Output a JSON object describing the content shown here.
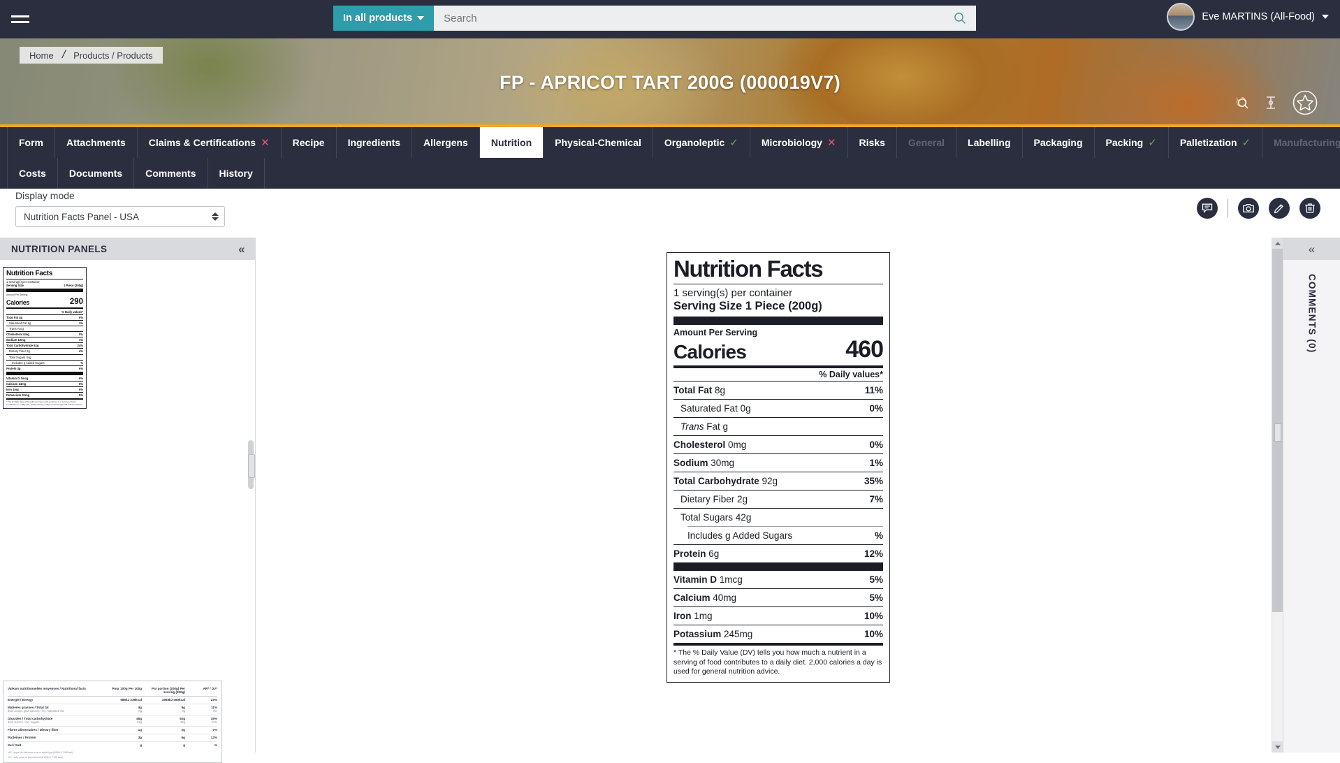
{
  "topbar": {
    "menu_icon": "hamburger-icon",
    "search_scope": "In all products",
    "search_placeholder": "Search",
    "search_value": "",
    "search_icon": "search-icon",
    "user_name": "Eve MARTINS (All-Food)"
  },
  "hero": {
    "breadcrumb_home": "Home",
    "breadcrumb_current": "Products / Products",
    "title": "FP - APRICOT TART 200G (000019V7)",
    "icons": [
      "history-search-icon",
      "compare-icon",
      "favorite-star-icon"
    ],
    "accent_color": "#f0a828"
  },
  "tabs_row1": [
    {
      "label": "Form",
      "state": "normal",
      "marker": ""
    },
    {
      "label": "Attachments",
      "state": "normal",
      "marker": ""
    },
    {
      "label": "Claims & Certifications",
      "state": "normal",
      "marker": "x"
    },
    {
      "label": "Recipe",
      "state": "normal",
      "marker": ""
    },
    {
      "label": "Ingredients",
      "state": "normal",
      "marker": ""
    },
    {
      "label": "Allergens",
      "state": "normal",
      "marker": ""
    },
    {
      "label": "Nutrition",
      "state": "active",
      "marker": ""
    },
    {
      "label": "Physical-Chemical",
      "state": "normal",
      "marker": ""
    },
    {
      "label": "Organoleptic",
      "state": "normal",
      "marker": "ok"
    },
    {
      "label": "Microbiology",
      "state": "normal",
      "marker": "x"
    },
    {
      "label": "Risks",
      "state": "normal",
      "marker": ""
    },
    {
      "label": "General",
      "state": "disabled",
      "marker": ""
    },
    {
      "label": "Labelling",
      "state": "normal",
      "marker": ""
    },
    {
      "label": "Packaging",
      "state": "normal",
      "marker": ""
    },
    {
      "label": "Packing",
      "state": "normal",
      "marker": "ok"
    },
    {
      "label": "Palletization",
      "state": "normal",
      "marker": "ok"
    },
    {
      "label": "Manufacturing process",
      "state": "disabled",
      "marker": ""
    }
  ],
  "tabs_row2": [
    {
      "label": "Costs",
      "state": "normal",
      "marker": ""
    },
    {
      "label": "Documents",
      "state": "normal",
      "marker": ""
    },
    {
      "label": "Comments",
      "state": "normal",
      "marker": ""
    },
    {
      "label": "History",
      "state": "normal",
      "marker": ""
    }
  ],
  "toolbar": {
    "display_mode_label": "Display mode",
    "display_mode_value": "Nutrition Facts Panel - USA",
    "actions": [
      "comment-icon",
      "camera-icon",
      "edit-pencil-icon",
      "delete-trash-icon"
    ]
  },
  "left_panel": {
    "title": "NUTRITION PANELS",
    "collapse_icon": "chevron-double-left-icon"
  },
  "right_rail": {
    "title": "COMMENTS (0)",
    "collapse_icon": "chevron-double-left-icon"
  },
  "nutrition_panel": {
    "title": "Nutrition Facts",
    "servings_per_container": "1 serving(s) per container",
    "serving_size_label": "Serving Size",
    "serving_size_value": "1 Piece (200g)",
    "amount_per_serving": "Amount Per Serving",
    "calories_label": "Calories",
    "calories_value": "460",
    "daily_values_header": "% Daily values*",
    "rows": [
      {
        "name": "Total Fat",
        "amount": "8g",
        "pct": "11%",
        "indent": 0,
        "bold": true,
        "italic": false
      },
      {
        "name": "Saturated Fat",
        "amount": "0g",
        "pct": "0%",
        "indent": 1,
        "bold": false,
        "italic": false
      },
      {
        "name": "Trans",
        "amount": "Fat g",
        "pct": "",
        "indent": 1,
        "bold": false,
        "italic": true
      },
      {
        "name": "Cholesterol",
        "amount": "0mg",
        "pct": "0%",
        "indent": 0,
        "bold": true,
        "italic": false
      },
      {
        "name": "Sodium",
        "amount": "30mg",
        "pct": "1%",
        "indent": 0,
        "bold": true,
        "italic": false
      },
      {
        "name": "Total Carbohydrate",
        "amount": "92g",
        "pct": "35%",
        "indent": 0,
        "bold": true,
        "italic": false
      },
      {
        "name": "Dietary Fiber",
        "amount": "2g",
        "pct": "7%",
        "indent": 1,
        "bold": false,
        "italic": false
      },
      {
        "name": "Total Sugars",
        "amount": "42g",
        "pct": "",
        "indent": 1,
        "bold": false,
        "italic": false
      },
      {
        "name": "Includes g Added Sugars",
        "amount": "",
        "pct": "%",
        "indent": 2,
        "bold": false,
        "italic": false
      },
      {
        "name": "Protein",
        "amount": "6g",
        "pct": "12%",
        "indent": 0,
        "bold": true,
        "italic": false
      }
    ],
    "micronutrients": [
      {
        "name": "Vitamin D",
        "amount": "1mcg",
        "pct": "5%"
      },
      {
        "name": "Calcium",
        "amount": "40mg",
        "pct": "5%"
      },
      {
        "name": "Iron",
        "amount": "1mg",
        "pct": "10%"
      },
      {
        "name": "Potassium",
        "amount": "245mg",
        "pct": "10%"
      }
    ],
    "footnote": "* The % Daily Value (DV) tells you how much a nutrient in a serving of food contributes to a daily diet. 2,000 calories a day is used for general nutrition advice."
  },
  "thumb_usa": {
    "title": "Nutrition Facts",
    "servings_per_container": "1 serving(s) per container",
    "serving_size_label": "Serving Size",
    "serving_size_value": "1 Piece (200g)",
    "amount_per_serving": "Amount Per Serving",
    "calories_label": "Calories",
    "calories_value": "290",
    "daily_values_header": "% Daily values*",
    "rows": [
      {
        "name": "Total Fat",
        "amount": "4g",
        "pct": "6%",
        "indent": 0,
        "bold": true
      },
      {
        "name": "Saturated Fat",
        "amount": "1g",
        "pct": "1%",
        "indent": 1,
        "bold": false
      },
      {
        "name": "Trans Fat g",
        "amount": "",
        "pct": "",
        "indent": 1,
        "bold": false
      },
      {
        "name": "Cholesterol",
        "amount": "0mg",
        "pct": "0%",
        "indent": 0,
        "bold": true
      },
      {
        "name": "Sodium",
        "amount": "10mg",
        "pct": "1%",
        "indent": 0,
        "bold": true
      },
      {
        "name": "Total Carbohydrate",
        "amount": "61g",
        "pct": "24%",
        "indent": 0,
        "bold": true
      },
      {
        "name": "Dietary Fiber",
        "amount": "2g",
        "pct": "4%",
        "indent": 1,
        "bold": false
      },
      {
        "name": "Total Sugars",
        "amount": "44g",
        "pct": "",
        "indent": 1,
        "bold": false
      },
      {
        "name": "Includes g Added Sugars",
        "amount": "",
        "pct": "%",
        "indent": 2,
        "bold": false
      },
      {
        "name": "Protein",
        "amount": "3g",
        "pct": "6%",
        "indent": 0,
        "bold": true
      }
    ],
    "micronutrients": [
      {
        "name": "Vitamin D",
        "amount": "1mcg",
        "pct": "6%"
      },
      {
        "name": "Calcium",
        "amount": "14mg",
        "pct": "6%"
      },
      {
        "name": "Iron",
        "amount": "1mg",
        "pct": "6%"
      },
      {
        "name": "Potassium",
        "amount": "91mg",
        "pct": "5%"
      }
    ],
    "footnote": "* The % Daily Value (DV) tells you how much a nutrient in a serving of food contributes to a daily diet. 2,000 calories a day is used for general nutrition advice."
  },
  "thumb_eu": {
    "headers": [
      "Valeurs nutritionnelles moyennes / Nutritional facts",
      "Pour 100g Per 100g",
      "Par portion (200g) Per serving (200g)",
      "AR* / DV*"
    ],
    "rows": [
      {
        "label": "Energie / Energy",
        "sub": "",
        "per100": "986kJ 236kcal",
        "perserv": "1968kJ 460kcal",
        "dv": "23%",
        "bold": true
      },
      {
        "label": "Matières grasses / Total fat",
        "sub": "dont acides gras saturés / inc. saturated fat",
        "per100": "4g",
        "per100sub": "0g",
        "perserv": "8g",
        "perservsub": "0g",
        "dv": "11%",
        "dvsub": "0%",
        "bold": true
      },
      {
        "label": "Glucides / Total carbohydrate",
        "sub": "dont sucres / inc. sugars",
        "per100": "46g",
        "per100sub": "21g",
        "perserv": "92g",
        "perservsub": "42g",
        "dv": "35%",
        "dvsub": "47%",
        "bold": true
      },
      {
        "label": "Fibres alimentaires / Dietary fiber",
        "sub": "",
        "per100": "1g",
        "perserv": "2g",
        "dv": "7%",
        "bold": true
      },
      {
        "label": "Protéines / Protein",
        "sub": "",
        "per100": "3g",
        "perserv": "6g",
        "dv": "12%",
        "bold": true
      },
      {
        "label": "Sel / Salt",
        "sub": "",
        "per100": "g",
        "perserv": "g",
        "dv": "%",
        "bold": true
      }
    ],
    "footnotes": [
      "*AR : apport de référence pour un adulte type (8400kJ / 2000kcal)",
      "*DV : daily value for general adult (8 400kJ / 2 000 kcal)"
    ]
  }
}
